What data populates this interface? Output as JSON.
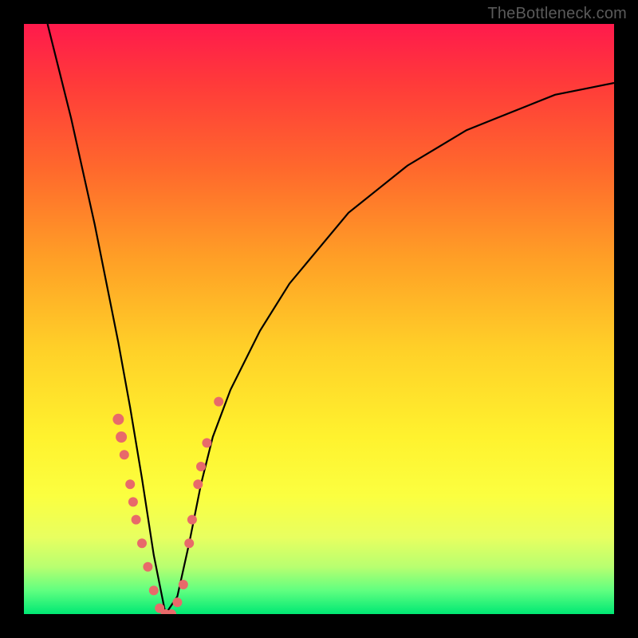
{
  "watermark": "TheBottleneck.com",
  "chart_data": {
    "type": "line",
    "title": "",
    "xlabel": "",
    "ylabel": "",
    "xlim": [
      0,
      100
    ],
    "ylim": [
      0,
      100
    ],
    "grid": false,
    "legend": false,
    "curve_description": "V-shaped bottleneck curve with minimum ~x=24, steep left arm, gradual right arm",
    "series": [
      {
        "name": "bottleneck-curve",
        "type": "line",
        "color": "#000000",
        "x": [
          4,
          6,
          8,
          10,
          12,
          14,
          16,
          18,
          20,
          22,
          24,
          26,
          28,
          30,
          32,
          35,
          40,
          45,
          50,
          55,
          60,
          65,
          70,
          75,
          80,
          85,
          90,
          95,
          100
        ],
        "y": [
          100,
          92,
          84,
          75,
          66,
          56,
          46,
          35,
          23,
          10,
          0,
          3,
          12,
          22,
          30,
          38,
          48,
          56,
          62,
          68,
          72,
          76,
          79,
          82,
          84,
          86,
          88,
          89,
          90
        ]
      },
      {
        "name": "left-arm-dots",
        "type": "scatter",
        "color": "#e86a6a",
        "points": [
          {
            "x": 16,
            "y": 33,
            "r": 7
          },
          {
            "x": 16.5,
            "y": 30,
            "r": 7
          },
          {
            "x": 17,
            "y": 27,
            "r": 6
          },
          {
            "x": 18,
            "y": 22,
            "r": 6
          },
          {
            "x": 18.5,
            "y": 19,
            "r": 6
          },
          {
            "x": 19,
            "y": 16,
            "r": 6
          },
          {
            "x": 20,
            "y": 12,
            "r": 6
          },
          {
            "x": 21,
            "y": 8,
            "r": 6
          },
          {
            "x": 22,
            "y": 4,
            "r": 6
          },
          {
            "x": 23,
            "y": 1,
            "r": 6
          },
          {
            "x": 24,
            "y": 0,
            "r": 6
          },
          {
            "x": 25,
            "y": 0,
            "r": 6
          }
        ]
      },
      {
        "name": "right-arm-dots",
        "type": "scatter",
        "color": "#e86a6a",
        "points": [
          {
            "x": 26,
            "y": 2,
            "r": 6
          },
          {
            "x": 27,
            "y": 5,
            "r": 6
          },
          {
            "x": 28,
            "y": 12,
            "r": 6
          },
          {
            "x": 28.5,
            "y": 16,
            "r": 6
          },
          {
            "x": 29.5,
            "y": 22,
            "r": 6
          },
          {
            "x": 30,
            "y": 25,
            "r": 6
          },
          {
            "x": 31,
            "y": 29,
            "r": 6
          },
          {
            "x": 33,
            "y": 36,
            "r": 6
          }
        ]
      }
    ],
    "background_gradient": {
      "top": "#ff1a4c",
      "upper_mid": "#ffa026",
      "mid": "#fff22e",
      "lower_mid": "#b8ff70",
      "bottom": "#00e874"
    }
  }
}
